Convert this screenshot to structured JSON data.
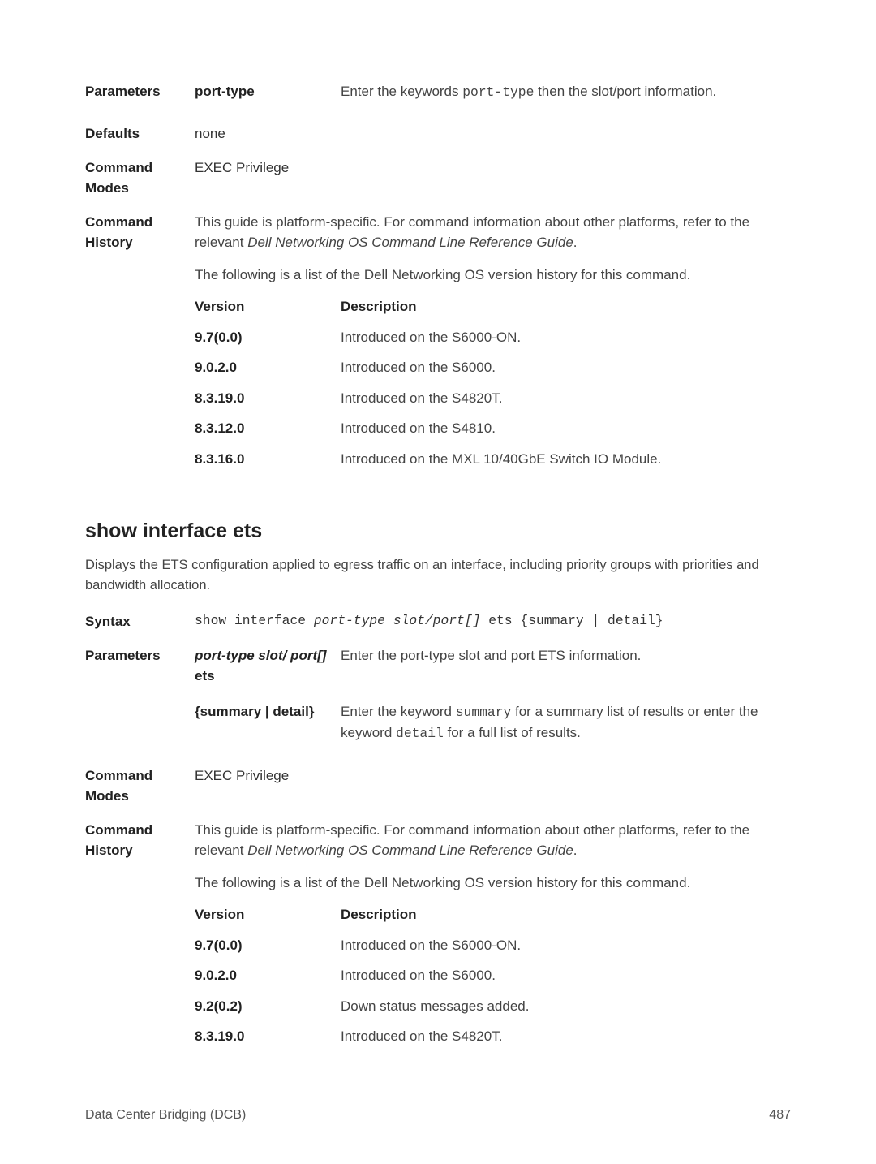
{
  "sec1": {
    "parametersLabel": "Parameters",
    "param1Term": "port-type",
    "param1DescA": "Enter the keywords ",
    "param1Code": "port-type",
    "param1DescB": " then the slot/port information.",
    "defaultsLabel": "Defaults",
    "defaultsValue": "none",
    "cmdModesLabel": "Command Modes",
    "cmdModesValue": "EXEC Privilege",
    "cmdHistoryLabel": "Command History",
    "historyPara1A": "This guide is platform-specific. For command information about other platforms, refer to the relevant ",
    "historyPara1Italic": "Dell Networking OS Command Line Reference Guide",
    "historyPara1B": ".",
    "historyPara2": "The following is a list of the Dell Networking OS version history for this command.",
    "versions": [
      {
        "v": "Version",
        "d": "Description"
      },
      {
        "v": "9.7(0.0)",
        "d": "Introduced on the S6000-ON."
      },
      {
        "v": "9.0.2.0",
        "d": "Introduced on the S6000."
      },
      {
        "v": "8.3.19.0",
        "d": "Introduced on the S4820T."
      },
      {
        "v": "8.3.12.0",
        "d": "Introduced on the S4810."
      },
      {
        "v": "8.3.16.0",
        "d": "Introduced on the MXL 10/40GbE Switch IO Module."
      }
    ]
  },
  "sec2": {
    "heading": "show interface ets",
    "intro": "Displays the ETS configuration applied to egress traffic on an interface, including priority groups with priorities and bandwidth allocation.",
    "syntaxLabel": "Syntax",
    "syntaxA": "show interface ",
    "syntaxItalic": "port-type slot/port[]",
    "syntaxB": " ets {summary | detail}",
    "parametersLabel": "Parameters",
    "param1Term": "port-type slot/ port[]",
    "param1TermSuffix": " ets",
    "param1Desc": "Enter the port-type slot and port ETS information.",
    "param2Term": "{summary | detail}",
    "param2DescA": "Enter the keyword ",
    "param2Code1": "summary",
    "param2DescB": " for a summary list of results or enter the keyword ",
    "param2Code2": "detail",
    "param2DescC": " for a full list of results.",
    "cmdModesLabel": "Command Modes",
    "cmdModesValue": "EXEC Privilege",
    "cmdHistoryLabel": "Command History",
    "historyPara1A": "This guide is platform-specific. For command information about other platforms, refer to the relevant ",
    "historyPara1Italic": "Dell Networking OS Command Line Reference Guide",
    "historyPara1B": ".",
    "historyPara2": "The following is a list of the Dell Networking OS version history for this command.",
    "versions": [
      {
        "v": "Version",
        "d": "Description"
      },
      {
        "v": "9.7(0.0)",
        "d": "Introduced on the S6000-ON."
      },
      {
        "v": "9.0.2.0",
        "d": "Introduced on the S6000."
      },
      {
        "v": "9.2(0.2)",
        "d": "Down status messages added."
      },
      {
        "v": "8.3.19.0",
        "d": "Introduced on the S4820T."
      }
    ]
  },
  "footer": {
    "left": "Data Center Bridging (DCB)",
    "right": "487"
  }
}
